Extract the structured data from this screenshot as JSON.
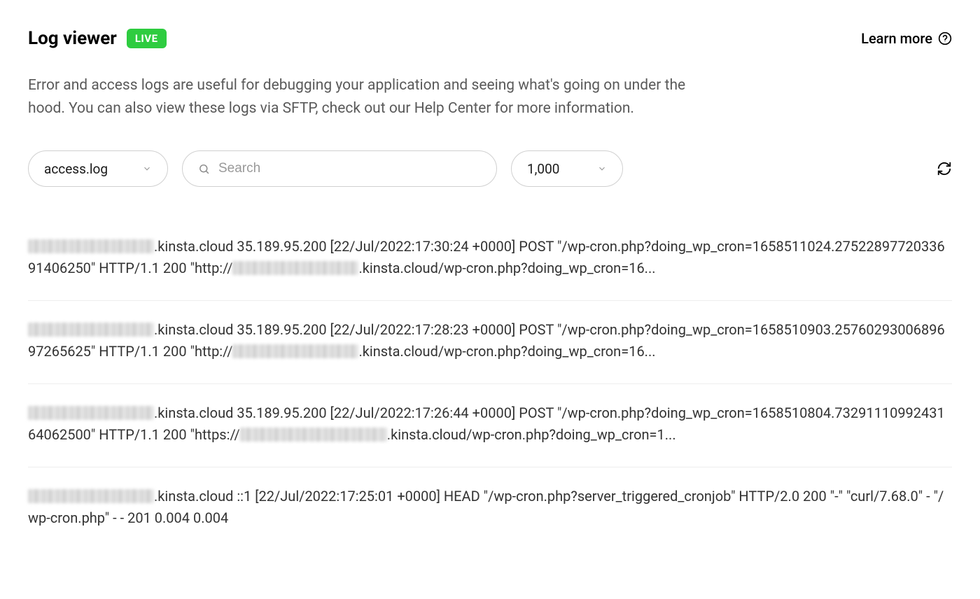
{
  "header": {
    "title": "Log viewer",
    "badge": "LIVE",
    "learn_more": "Learn more"
  },
  "description": "Error and access logs are useful for debugging your application and seeing what's going on under the hood. You can also view these logs via SFTP, check out our Help Center for more information.",
  "controls": {
    "log_type": "access.log",
    "search_placeholder": "Search",
    "count": "1,000"
  },
  "logs": [
    {
      "pre": ".kinsta.cloud 35.189.95.200 [22/Jul/2022:17:30:24 +0000] POST \"/wp-cron.php?doing_wp_cron=1658511024.2752289772033691406250\" HTTP/1.1 200 \"http://",
      "post": ".kinsta.cloud/wp-cron.php?doing_wp_cron=16..."
    },
    {
      "pre": ".kinsta.cloud 35.189.95.200 [22/Jul/2022:17:28:23 +0000] POST \"/wp-cron.php?doing_wp_cron=1658510903.2576029300689697265625\" HTTP/1.1 200 \"http://",
      "post": ".kinsta.cloud/wp-cron.php?doing_wp_cron=16..."
    },
    {
      "pre": ".kinsta.cloud 35.189.95.200 [22/Jul/2022:17:26:44 +0000] POST \"/wp-cron.php?doing_wp_cron=1658510804.7329111099243164062500\" HTTP/1.1 200 \"https://",
      "post": ".kinsta.cloud/wp-cron.php?doing_wp_cron=1..."
    },
    {
      "pre": ".kinsta.cloud ::1 [22/Jul/2022:17:25:01 +0000] HEAD \"/wp-cron.php?server_triggered_cronjob\" HTTP/2.0 200 \"-\" \"curl/7.68.0\" - \"/wp-cron.php\" - - 201 0.004 0.004",
      "post": ""
    }
  ]
}
